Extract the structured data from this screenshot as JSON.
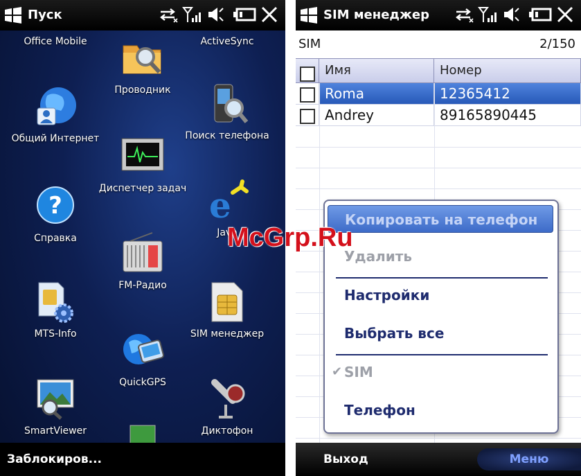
{
  "left_screen": {
    "title": "Пуск",
    "tiles": [
      {
        "label": "Office Mobile",
        "icon": "office-mobile-icon"
      },
      {
        "label": "Проводник",
        "icon": "folder-magnifier-icon"
      },
      {
        "label": "ActiveSync",
        "icon": "activesync-icon"
      },
      {
        "label": "Общий Интернет",
        "icon": "globe-user-icon"
      },
      {
        "label": "Поиск телефона",
        "icon": "phone-search-icon"
      },
      {
        "label": "Диспетчер задач",
        "icon": "task-manager-icon"
      },
      {
        "label": "Справка",
        "icon": "help-icon"
      },
      {
        "label": "FM-Радио",
        "icon": "radio-icon"
      },
      {
        "label": "Java",
        "icon": "java-icon"
      },
      {
        "label": "MTS-Info",
        "icon": "sim-gear-icon"
      },
      {
        "label": "SIM менеджер",
        "icon": "sim-card-icon"
      },
      {
        "label": "QuickGPS",
        "icon": "gps-globe-icon"
      },
      {
        "label": "SmartViewer",
        "icon": "image-viewer-icon"
      },
      {
        "label": "Диктофон",
        "icon": "microphone-icon"
      }
    ],
    "softkey_left": "Заблокиров..."
  },
  "right_screen": {
    "title": "SIM менеджер",
    "sim_label": "SIM",
    "counter": "2/150",
    "columns": {
      "name": "Имя",
      "number": "Номер"
    },
    "rows": [
      {
        "name": "Roma",
        "number": "12365412",
        "selected": true
      },
      {
        "name": "Andrey",
        "number": "89165890445",
        "selected": false
      }
    ],
    "menu": {
      "copy_to_phone": "Копировать на телефон",
      "delete": "Удалить",
      "settings": "Настройки",
      "select_all": "Выбрать все",
      "sim": "SIM",
      "phone": "Телефон"
    },
    "softkey_left": "Выход",
    "softkey_right": "Меню"
  },
  "watermark": "McGrp.Ru",
  "colors": {
    "selection": "#3d6bc8",
    "menu_text": "#1e2b6e",
    "disabled": "#9da0a8",
    "watermark": "#d4101b"
  }
}
